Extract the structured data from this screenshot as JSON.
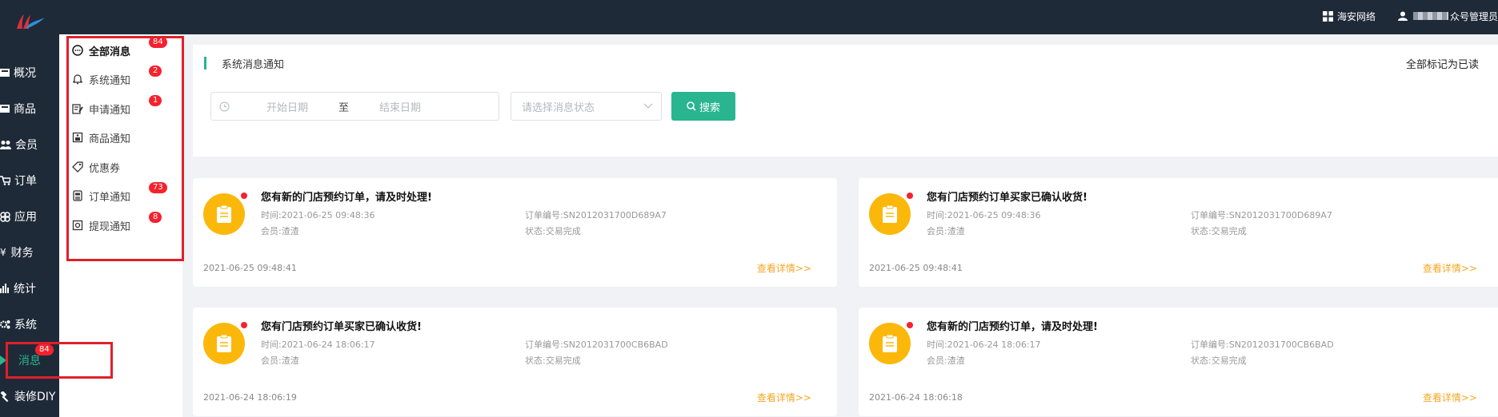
{
  "header": {
    "org_label": "海安网络",
    "user_label_suffix": "众号管理员"
  },
  "sidebar": {
    "items": [
      {
        "label": "概况",
        "icon": "dashboard-icon"
      },
      {
        "label": "商品",
        "icon": "goods-icon"
      },
      {
        "label": "会员",
        "icon": "members-icon"
      },
      {
        "label": "订单",
        "icon": "cart-icon"
      },
      {
        "label": "应用",
        "icon": "apps-icon"
      },
      {
        "label": "财务",
        "icon": "yen-icon"
      },
      {
        "label": "统计",
        "icon": "bar-chart-icon"
      },
      {
        "label": "系统",
        "icon": "gear-icon"
      },
      {
        "label": "消息",
        "icon": "message-icon",
        "badge": "84",
        "active": true
      },
      {
        "label": "装修DIY",
        "icon": "hammer-icon"
      }
    ]
  },
  "submenu": {
    "items": [
      {
        "label": "全部消息",
        "badge": "84",
        "active": true
      },
      {
        "label": "系统通知",
        "badge": "2"
      },
      {
        "label": "申请通知",
        "badge": "1"
      },
      {
        "label": "商品通知",
        "badge": ""
      },
      {
        "label": "优惠券",
        "badge": ""
      },
      {
        "label": "订单通知",
        "badge": "73"
      },
      {
        "label": "提现通知",
        "badge": "8"
      }
    ]
  },
  "filter": {
    "title": "系统消息通知",
    "mark_all_read": "全部标记为已读",
    "start_placeholder": "开始日期",
    "range_separator": "至",
    "end_placeholder": "结束日期",
    "status_placeholder": "请选择消息状态",
    "search_label": "搜索"
  },
  "messages": [
    {
      "title": "您有新的门店预约订单，请及时处理!",
      "time": "时间:2021-06-25 09:48:36",
      "member": "会员:渣渣",
      "order_no": "订单编号:SN2012031700D689A7",
      "status": "状态:交易完成",
      "created": "2021-06-25 09:48:41",
      "link": "查看详情>>"
    },
    {
      "title": "您有门店预约订单买家已确认收货!",
      "time": "时间:2021-06-25 09:48:36",
      "member": "会员:渣渣",
      "order_no": "订单编号:SN2012031700D689A7",
      "status": "状态:交易完成",
      "created": "2021-06-25 09:48:41",
      "link": "查看详情>>"
    },
    {
      "title": "您有门店预约订单买家已确认收货!",
      "time": "时间:2021-06-24 18:06:17",
      "member": "会员:渣渣",
      "order_no": "订单编号:SN2012031700CB6BAD",
      "status": "状态:交易完成",
      "created": "2021-06-24 18:06:19",
      "link": "查看详情>>"
    },
    {
      "title": "您有新的门店预约订单，请及时处理!",
      "time": "时间:2021-06-24 18:06:17",
      "member": "会员:渣渣",
      "order_no": "订单编号:SN2012031700CB6BAD",
      "status": "状态:交易完成",
      "created": "2021-06-24 18:06:18",
      "link": "查看详情>>"
    }
  ],
  "colors": {
    "sidebar_bg": "#1f2a38",
    "accent_green": "#29b58f",
    "badge_red": "#f5222d",
    "icon_yellow": "#fbb80a",
    "link_orange": "#f5a623"
  }
}
